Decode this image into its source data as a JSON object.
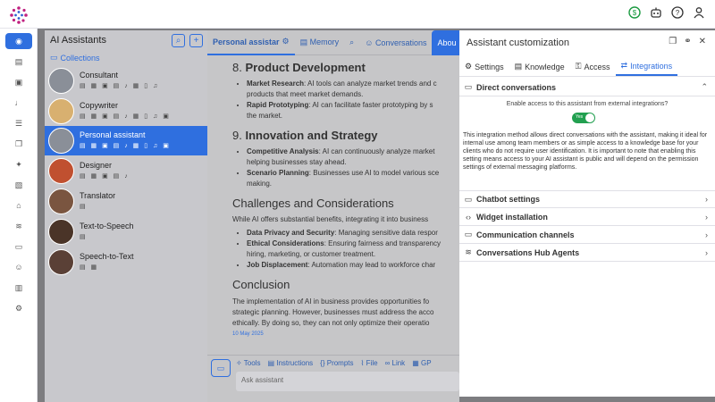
{
  "topbar": {
    "icons": [
      "dollar-icon",
      "robot-icon",
      "help-icon",
      "user-icon"
    ]
  },
  "assistants": {
    "title": "AI Assistants",
    "collections_label": "Collections",
    "items": [
      {
        "name": "Consultant",
        "caps": "▤ ▦ ▣ ▤ ♪ ▦ ▯ ♫"
      },
      {
        "name": "Copywriter",
        "caps": "▤ ▦ ▣ ▤ ♪ ▦ ▯ ♫ ▣"
      },
      {
        "name": "Personal assistant",
        "caps": "▤ ▦ ▣ ▤ ♪ ▦ ▯ ♫ ▣"
      },
      {
        "name": "Designer",
        "caps": "▤ ▦ ▣ ▤ ♪"
      },
      {
        "name": "Translator",
        "caps": "▤"
      },
      {
        "name": "Text-to-Speech",
        "caps": "▤"
      },
      {
        "name": "Speech-to-Text",
        "caps": "▤ ▦"
      }
    ]
  },
  "doc_tabs": {
    "personal": "Personal assistar",
    "memory": "Memory",
    "conversations": "Conversations",
    "about": "Abou"
  },
  "document": {
    "h8_num": "8.",
    "h8_title": "Product Development",
    "h8_items": [
      {
        "b": "Market Research",
        "t": ": AI tools can analyze market trends and c"
      },
      {
        "b": "",
        "t": "products that meet market demands."
      },
      {
        "b": "Rapid Prototyping",
        "t": ": AI can facilitate faster prototyping by s"
      },
      {
        "b": "",
        "t": "the market."
      }
    ],
    "h9_num": "9.",
    "h9_title": "Innovation and Strategy",
    "h9_items": [
      {
        "b": "Competitive Analysis",
        "t": ": AI can continuously analyze market"
      },
      {
        "b": "",
        "t": "helping businesses stay ahead."
      },
      {
        "b": "Scenario Planning",
        "t": ": Businesses use AI to model various sce"
      },
      {
        "b": "",
        "t": "making."
      }
    ],
    "challenges_title": "Challenges and Considerations",
    "challenges_intro": "While AI offers substantial benefits, integrating it into business",
    "challenges_items": [
      {
        "b": "Data Privacy and Security",
        "t": ": Managing sensitive data respor"
      },
      {
        "b": "Ethical Considerations",
        "t": ": Ensuring fairness and transparency"
      },
      {
        "b": "",
        "t": "hiring, marketing, or customer treatment."
      },
      {
        "b": "Job Displacement",
        "t": ": Automation may lead to workforce char"
      }
    ],
    "conclusion_title": "Conclusion",
    "conclusion_lines": [
      "The implementation of AI in business provides opportunities fo",
      "strategic planning. However, businesses must address the acco",
      "ethically. By doing so, they can not only optimize their operatio"
    ],
    "date": "10 May 2025"
  },
  "toolbar": {
    "tools": "Tools",
    "instructions": "Instructions",
    "prompts": "Prompts",
    "file": "File",
    "link": "Link",
    "gpt": "GP"
  },
  "ask_placeholder": "Ask assistant",
  "panel": {
    "title": "Assistant customization",
    "tabs": {
      "settings": "Settings",
      "knowledge": "Knowledge",
      "access": "Access",
      "integrations": "Integrations"
    },
    "direct": {
      "title": "Direct conversations",
      "question": "Enable access to this assistant from external integrations?",
      "toggle_label": "Yes",
      "toggle_on": true,
      "description": "This integration method allows direct conversations with the assistant, making it ideal for internal use among team members or as simple access to a knowledge base for your clients who do not require user identification. It is important to note that enabling this setting means access to your AI assistant is public and will depend on the permission settings of external messaging platforms."
    },
    "sections": [
      "Chatbot settings",
      "Widget installation",
      "Communication channels",
      "Conversations Hub Agents"
    ]
  },
  "colors": {
    "accent": "#2f6fdf",
    "toggle": "#22a050",
    "overlay": "#7d7d80"
  }
}
